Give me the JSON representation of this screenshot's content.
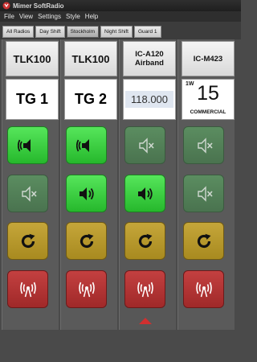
{
  "window": {
    "title": "Mimer SoftRadio"
  },
  "menu": [
    "File",
    "View",
    "Settings",
    "Style",
    "Help"
  ],
  "tabs": [
    {
      "label": "All Radios",
      "active": false
    },
    {
      "label": "Day Shift",
      "active": false
    },
    {
      "label": "Stockholm",
      "active": true
    },
    {
      "label": "Night Shift",
      "active": false
    },
    {
      "label": "Guard 1",
      "active": false
    }
  ],
  "radios": [
    {
      "name": "TLK100",
      "talkgroup": "TG 1",
      "speaker": "on",
      "mute": "off"
    },
    {
      "name": "TLK100",
      "talkgroup": "TG 2",
      "speaker": "on",
      "mute": "on"
    },
    {
      "name": "IC-A120\nAirband",
      "frequency": "118.000",
      "speaker": "off",
      "mute": "on",
      "selected": true
    },
    {
      "name": "IC-M423",
      "channel": {
        "power": "1W",
        "number": "15",
        "name": "COMMERCIAL"
      },
      "speaker": "off",
      "mute": "off"
    }
  ],
  "icons": {
    "speaker_active": "speaker-active-icon",
    "speaker_muted": "speaker-muted-icon",
    "volume": "volume-icon",
    "reset": "reset-icon",
    "transmit": "transmit-icon"
  },
  "colors": {
    "green": "#2fd036",
    "dim_green": "#4c8a55",
    "yellow": "#b8981f",
    "red": "#b03030",
    "selection_arrow": "#d03030"
  }
}
